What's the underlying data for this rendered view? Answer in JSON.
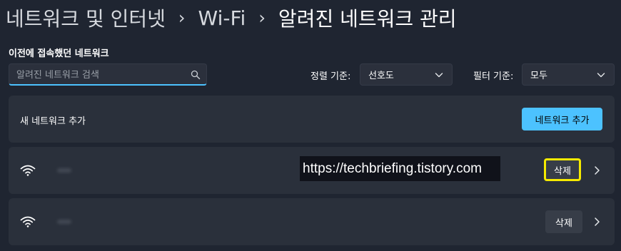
{
  "breadcrumb": {
    "item1": "네트워크 및 인터넷",
    "item2": "Wi-Fi",
    "current": "알려진 네트워크 관리",
    "separator": "›"
  },
  "section": {
    "title": "이전에 접속했던 네트워크"
  },
  "search": {
    "placeholder": "알려진 네트워크 검색",
    "value": ""
  },
  "sort": {
    "label": "정렬 기준:",
    "value": "선호도"
  },
  "filter": {
    "label": "필터 기준:",
    "value": "모두"
  },
  "add_network": {
    "text": "새 네트워크 추가",
    "button_label": "네트워크 추가"
  },
  "networks": [
    {
      "delete_label": "삭제"
    },
    {
      "delete_label": "삭제"
    }
  ],
  "watermark": "https://techbriefing.tistory.com",
  "colors": {
    "accent": "#4cc2ff",
    "highlight": "#f6ea00",
    "background": "#1f2531",
    "card": "#2a303b"
  },
  "icons": [
    "search-icon",
    "chevron-down-icon",
    "wifi-icon",
    "chevron-right-icon"
  ]
}
